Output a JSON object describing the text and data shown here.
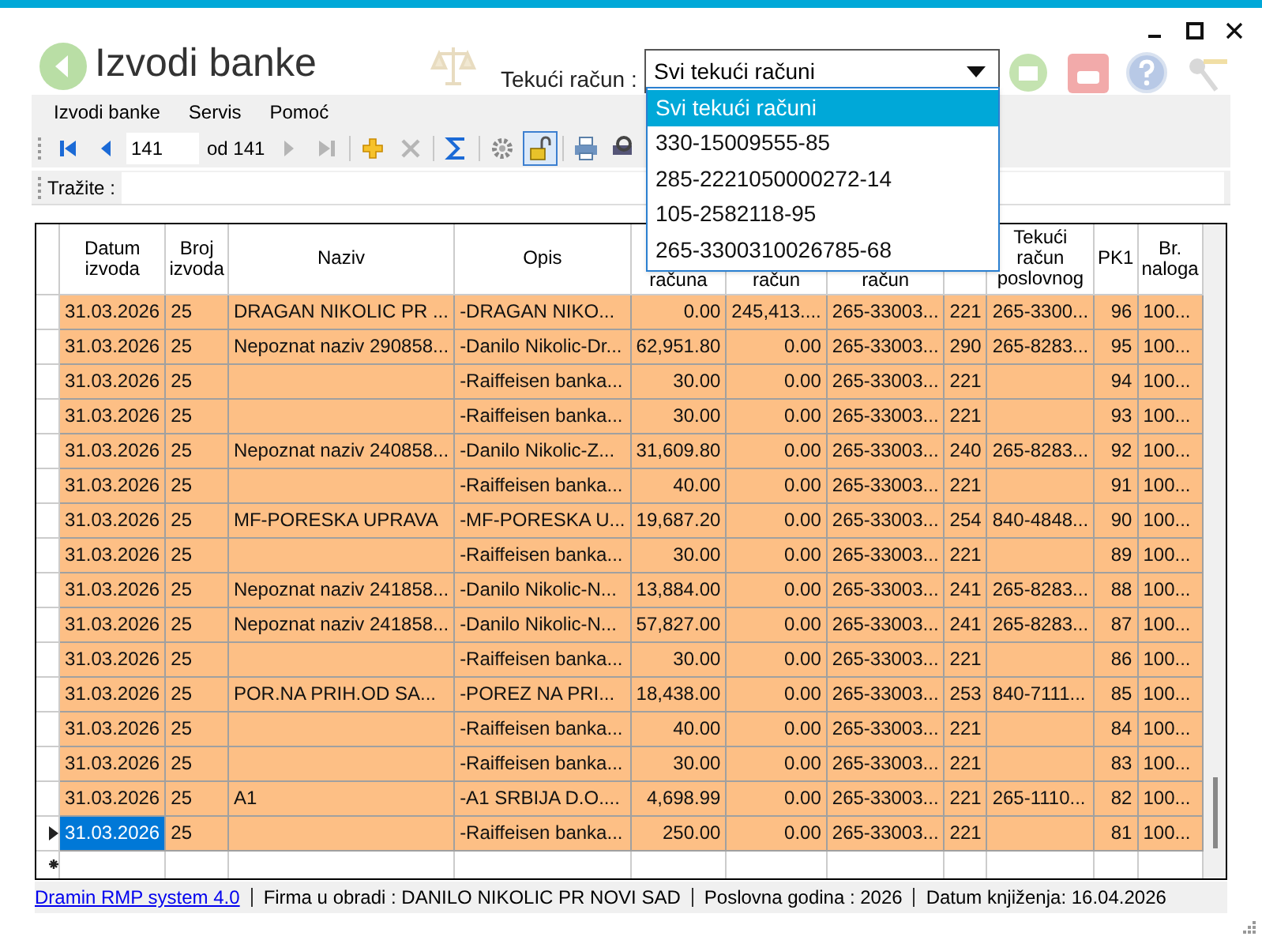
{
  "window": {
    "title": "Izvodi banke"
  },
  "account_filter": {
    "label": "Tekući račun :",
    "value": "Svi tekući računi",
    "expanded": true,
    "options": [
      {
        "label": "Svi tekući računi",
        "selected": true
      },
      {
        "label": "330-15009555-85",
        "selected": false
      },
      {
        "label": "285-2221050000272-14",
        "selected": false
      },
      {
        "label": "105-2582118-95",
        "selected": false
      },
      {
        "label": "265-3300310026785-68",
        "selected": false
      }
    ]
  },
  "menu": [
    "Izvodi banke",
    "Servis",
    "Pomoć"
  ],
  "toolbar": [
    {
      "kind": "first"
    },
    {
      "kind": "prev"
    },
    {
      "kind": "position",
      "value": "141"
    },
    {
      "kind": "count",
      "label": "od 141"
    },
    {
      "kind": "next",
      "disabled": true
    },
    {
      "kind": "last",
      "disabled": true
    },
    {
      "kind": "sep"
    },
    {
      "kind": "add"
    },
    {
      "kind": "delete",
      "disabled": true
    },
    {
      "kind": "sep"
    },
    {
      "kind": "sum"
    },
    {
      "kind": "sep"
    },
    {
      "kind": "gear"
    },
    {
      "kind": "lock",
      "pressed": true
    },
    {
      "kind": "sep"
    },
    {
      "kind": "print"
    },
    {
      "kind": "print_setup"
    }
  ],
  "search": {
    "label": "Tražite :"
  },
  "table": {
    "columns": [
      "Datum izvoda",
      "Broj izvoda",
      "Naziv",
      "Opis",
      "računa",
      "račun",
      "račun",
      "",
      "Tekući račun poslovnog",
      "PK1",
      "Br. naloga"
    ],
    "rows": [
      {
        "selected": false,
        "cells": [
          "31.03.2026",
          "25",
          "DRAGAN NIKOLIC PR ...",
          "-DRAGAN NIKO...",
          "0.00",
          "245,413....",
          "265-33003...",
          "221",
          "265-3300...",
          "96",
          "100..."
        ]
      },
      {
        "selected": false,
        "cells": [
          "31.03.2026",
          "25",
          "Nepoznat naziv 290858...",
          "-Danilo Nikolic-Dr...",
          "62,951.80",
          "0.00",
          "265-33003...",
          "290",
          "265-8283...",
          "95",
          "100..."
        ]
      },
      {
        "selected": false,
        "cells": [
          "31.03.2026",
          "25",
          "",
          "-Raiffeisen banka...",
          "30.00",
          "0.00",
          "265-33003...",
          "221",
          "",
          "94",
          "100..."
        ]
      },
      {
        "selected": false,
        "cells": [
          "31.03.2026",
          "25",
          "",
          "-Raiffeisen banka...",
          "30.00",
          "0.00",
          "265-33003...",
          "221",
          "",
          "93",
          "100..."
        ]
      },
      {
        "selected": false,
        "cells": [
          "31.03.2026",
          "25",
          "Nepoznat naziv 240858...",
          "-Danilo Nikolic-Z...",
          "31,609.80",
          "0.00",
          "265-33003...",
          "240",
          "265-8283...",
          "92",
          "100..."
        ]
      },
      {
        "selected": false,
        "cells": [
          "31.03.2026",
          "25",
          "",
          "-Raiffeisen banka...",
          "40.00",
          "0.00",
          "265-33003...",
          "221",
          "",
          "91",
          "100..."
        ]
      },
      {
        "selected": false,
        "cells": [
          "31.03.2026",
          "25",
          "MF-PORESKA UPRAVA",
          "-MF-PORESKA U...",
          "19,687.20",
          "0.00",
          "265-33003...",
          "254",
          "840-4848...",
          "90",
          "100..."
        ]
      },
      {
        "selected": false,
        "cells": [
          "31.03.2026",
          "25",
          "",
          "-Raiffeisen banka...",
          "30.00",
          "0.00",
          "265-33003...",
          "221",
          "",
          "89",
          "100..."
        ]
      },
      {
        "selected": false,
        "cells": [
          "31.03.2026",
          "25",
          "Nepoznat naziv 241858...",
          "-Danilo Nikolic-N...",
          "13,884.00",
          "0.00",
          "265-33003...",
          "241",
          "265-8283...",
          "88",
          "100..."
        ]
      },
      {
        "selected": false,
        "cells": [
          "31.03.2026",
          "25",
          "Nepoznat naziv 241858...",
          "-Danilo Nikolic-N...",
          "57,827.00",
          "0.00",
          "265-33003...",
          "241",
          "265-8283...",
          "87",
          "100..."
        ]
      },
      {
        "selected": false,
        "cells": [
          "31.03.2026",
          "25",
          "",
          "-Raiffeisen banka...",
          "30.00",
          "0.00",
          "265-33003...",
          "221",
          "",
          "86",
          "100..."
        ]
      },
      {
        "selected": false,
        "cells": [
          "31.03.2026",
          "25",
          "POR.NA PRIH.OD SA...",
          "-POREZ NA PRI...",
          "18,438.00",
          "0.00",
          "265-33003...",
          "253",
          "840-7111...",
          "85",
          "100..."
        ]
      },
      {
        "selected": false,
        "cells": [
          "31.03.2026",
          "25",
          "",
          "-Raiffeisen banka...",
          "40.00",
          "0.00",
          "265-33003...",
          "221",
          "",
          "84",
          "100..."
        ]
      },
      {
        "selected": false,
        "cells": [
          "31.03.2026",
          "25",
          "",
          "-Raiffeisen banka...",
          "30.00",
          "0.00",
          "265-33003...",
          "221",
          "",
          "83",
          "100..."
        ]
      },
      {
        "selected": false,
        "cells": [
          "31.03.2026",
          "25",
          "A1",
          "-A1 SRBIJA D.O....",
          "4,698.99",
          "0.00",
          "265-33003...",
          "221",
          "265-1110...",
          "82",
          "100..."
        ]
      },
      {
        "selected": true,
        "cells": [
          "31.03.2026",
          "25",
          "",
          "-Raiffeisen banka...",
          "250.00",
          "0.00",
          "265-33003...",
          "221",
          "",
          "81",
          "100..."
        ]
      }
    ]
  },
  "status_bar": {
    "link": "Dramin RMP system 4.0",
    "items": [
      "Firma u obradi : DANILO NIKOLIC PR NOVI SAD",
      "Poslovna godina : 2026",
      "Datum knjiženja: 16.04.2026"
    ]
  }
}
